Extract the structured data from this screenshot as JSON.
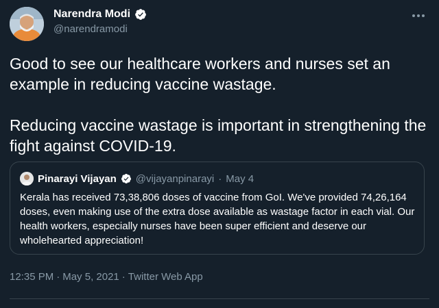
{
  "tweet": {
    "author": {
      "name": "Narendra Modi",
      "handle": "@narendramodi",
      "avatar_icon": "profile-photo"
    },
    "more_icon": "ellipsis-icon",
    "paragraphs": [
      "Good to see our healthcare workers and nurses set an example in reducing vaccine wastage.",
      "Reducing vaccine wastage is important in strengthening the fight against COVID-19."
    ],
    "quoted": {
      "name": "Pinarayi Vijayan",
      "handle": "@vijayanpinarayi",
      "separator": "·",
      "date": "May 4",
      "text": "Kerala has received 73,38,806 doses of vaccine from GoI. We've provided 74,26,164 doses, even making use of the extra dose available as wastage factor in each vial. Our health workers, especially nurses have been super efficient and deserve our wholehearted appreciation!"
    },
    "meta": {
      "time": "12:35 PM",
      "separator": "·",
      "date": "May 5, 2021",
      "sep2": "·",
      "source": "Twitter Web App"
    }
  },
  "colors": {
    "background": "#15202b",
    "secondary_text": "#8899a6",
    "verified_badge": "#ffffff",
    "border": "#38444d"
  }
}
